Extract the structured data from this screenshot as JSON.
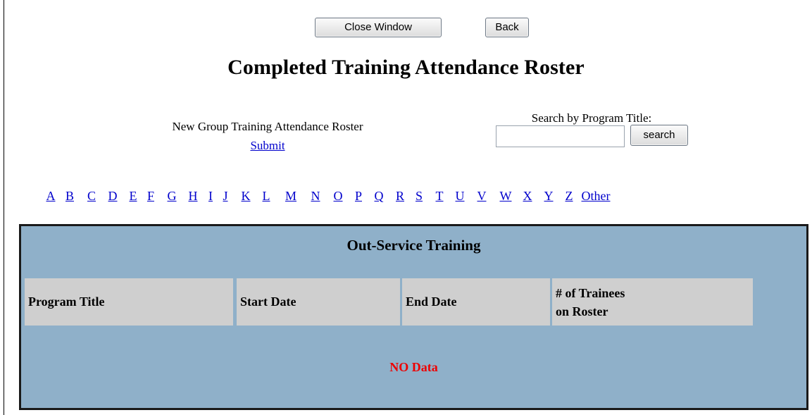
{
  "toolbar": {
    "close_label": "Close Window",
    "back_label": "Back"
  },
  "page": {
    "title": "Completed Training Attendance Roster"
  },
  "new_roster": {
    "label": "New Group Training Attendance Roster",
    "link": "Submit"
  },
  "search": {
    "label": "Search by Program Title:",
    "value": "",
    "placeholder": "",
    "button": "search"
  },
  "alphabet": [
    "A",
    "B",
    "C",
    "D",
    "E",
    "F",
    "G",
    "H",
    "I",
    "J",
    "K",
    "L",
    "M",
    "N",
    "O",
    "P",
    "Q",
    "R",
    "S",
    "T",
    "U",
    "V",
    "W",
    "X",
    "Y",
    "Z",
    "Other"
  ],
  "panel": {
    "title": "Out-Service Training",
    "columns": [
      "Program Title",
      "Start Date",
      "End Date",
      "# of Trainees",
      "on Roster"
    ],
    "empty_message": "NO Data",
    "background": "#8fb0c9",
    "header_background": "#cfcfcf",
    "empty_color": "#ee0000"
  },
  "colors": {
    "link": "#0000cc"
  }
}
